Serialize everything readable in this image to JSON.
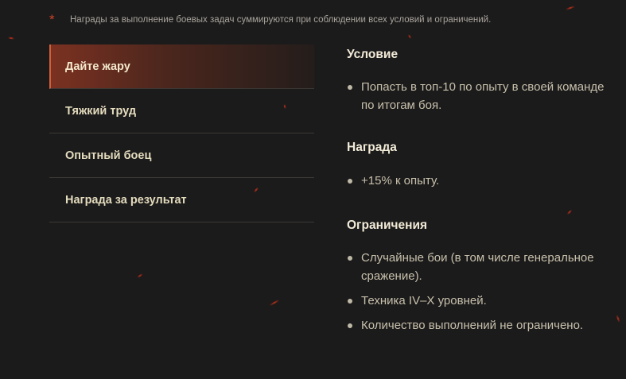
{
  "note": {
    "star": "*",
    "text": "Награды за выполнение боевых задач суммируются при соблюдении всех условий и ограничений."
  },
  "tabs": [
    {
      "label": "Дайте жару",
      "active": true
    },
    {
      "label": "Тяжкий труд",
      "active": false
    },
    {
      "label": "Опытный боец",
      "active": false
    },
    {
      "label": "Награда за результат",
      "active": false
    }
  ],
  "condition": {
    "title": "Условие",
    "items": [
      "Попасть в топ-10 по опыту в своей команде по итогам боя."
    ]
  },
  "reward": {
    "title": "Награда",
    "items": [
      "+15% к опыту."
    ]
  },
  "restrictions": {
    "title": "Ограничения",
    "items": [
      "Случайные бои (в том числе генеральное сражение).",
      "Техника IV–X уровней.",
      "Количество выполнений не ограничено."
    ]
  },
  "colors": {
    "background": "#1c1b1b",
    "accent": "#c8432a",
    "active_tab": "#7b3121"
  }
}
